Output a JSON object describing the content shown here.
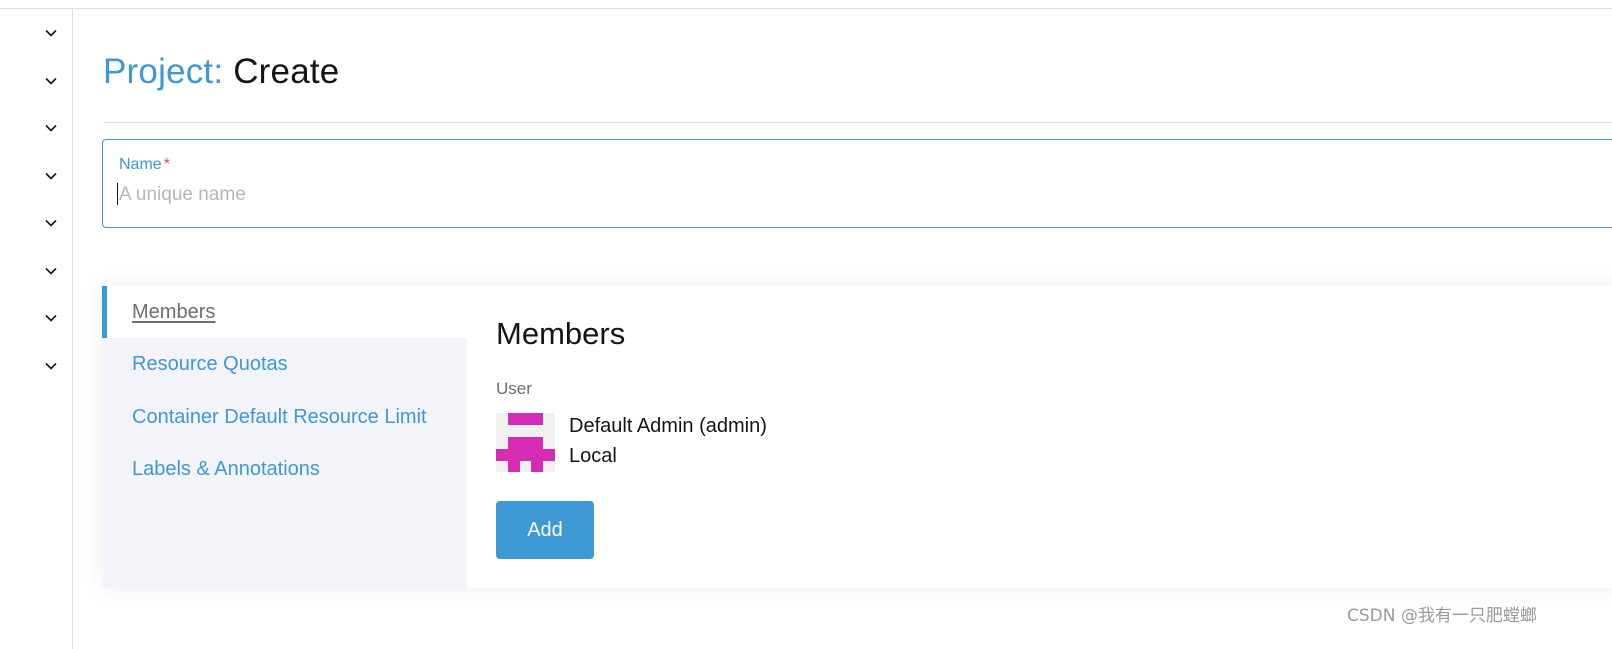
{
  "colors": {
    "accent": "#3d98d3",
    "required": "#f64747",
    "sidebar_bg": "#f3f4f9",
    "avatar_magenta": "#d62bb4"
  },
  "left_rail": {
    "chevron_count": 8,
    "icon": "chevron-down-icon"
  },
  "header": {
    "title_prefix": "Project:",
    "title_action": "Create"
  },
  "name_field": {
    "label": "Name",
    "required_mark": "*",
    "value": "",
    "placeholder": "A unique name"
  },
  "tabs": [
    {
      "label": "Members",
      "active": true
    },
    {
      "label": "Resource Quotas",
      "active": false
    },
    {
      "label": "Container Default Resource Limit",
      "active": false
    },
    {
      "label": "Labels & Annotations",
      "active": false
    }
  ],
  "members_section": {
    "title": "Members",
    "user_label": "User",
    "member": {
      "name": "Default Admin (admin)",
      "provider": "Local",
      "avatar_icon": "identicon-avatar"
    },
    "add_label": "Add"
  },
  "watermark": "CSDN @我有一只肥螳螂"
}
